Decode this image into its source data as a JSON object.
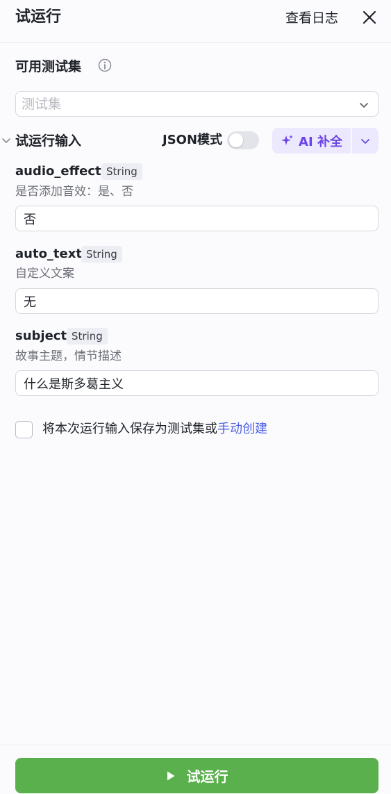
{
  "header": {
    "title": "试运行",
    "view_log": "查看日志"
  },
  "testset": {
    "label": "可用测试集",
    "placeholder": "测试集"
  },
  "inputs": {
    "title": "试运行输入",
    "json_mode_label": "JSON模式",
    "json_mode_on": false,
    "ai_button_label": "AI 补全"
  },
  "fields": [
    {
      "name": "audio_effect",
      "type": "String",
      "description": "是否添加音效：是、否",
      "value": "否"
    },
    {
      "name": "auto_text",
      "type": "String",
      "description": "自定义文案",
      "value": "无"
    },
    {
      "name": "subject",
      "type": "String",
      "description": "故事主题，情节描述",
      "value": "什么是斯多葛主义"
    }
  ],
  "save_option": {
    "text": "将本次运行输入保存为测试集或",
    "link": "手动创建",
    "checked": false
  },
  "footer": {
    "run_label": "试运行"
  },
  "colors": {
    "accent": "#6a45e6",
    "run_button": "#5bb04e",
    "link": "#4e60e8"
  }
}
